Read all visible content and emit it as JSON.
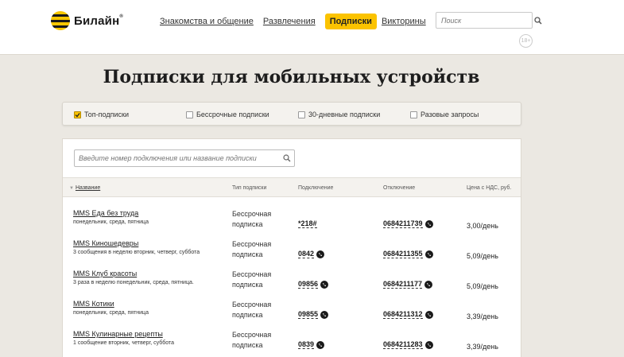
{
  "header": {
    "brand": "Билайн",
    "brand_mark": "®",
    "nav": [
      {
        "label": "Знакомства и общение",
        "active": false
      },
      {
        "label": "Развлечения",
        "active": false
      },
      {
        "label": "Подписки",
        "active": true
      },
      {
        "label": "Викторины",
        "active": false
      }
    ],
    "search_placeholder": "Поиск",
    "age_badge": "18+"
  },
  "page_title": "Подписки для мобильных устройств",
  "filters": [
    {
      "label": "Топ-подписки",
      "checked": true
    },
    {
      "label": "Бессрочные подписки",
      "checked": false
    },
    {
      "label": "30-дневные подписки",
      "checked": false
    },
    {
      "label": "Разовые запросы",
      "checked": false
    }
  ],
  "subscription_search": {
    "placeholder": "Введите номер подключения или название подписки"
  },
  "table": {
    "columns": {
      "name": "Название",
      "type": "Тип подписки",
      "connect": "Подключение",
      "disconnect": "Отключение",
      "price": "Цена с НДС, руб."
    },
    "rows": [
      {
        "name": "MMS Еда без труда",
        "desc": "понедельник, среда, пятница",
        "type": "Бессрочная подписка",
        "connect": "*218#",
        "connect_call": false,
        "disconnect": "0684211739",
        "price": "3,00/день"
      },
      {
        "name": "MMS Киношедевры",
        "desc": "3 сообщения в неделю вторник, четверг, суббота",
        "type": "Бессрочная подписка",
        "connect": "0842",
        "connect_call": true,
        "disconnect": "0684211355",
        "price": "5,09/день"
      },
      {
        "name": "MMS Клуб красоты",
        "desc": "3 раза в неделю понедельник, среда, пятница.",
        "type": "Бессрочная подписка",
        "connect": "09856",
        "connect_call": true,
        "disconnect": "0684211177",
        "price": "5,09/день"
      },
      {
        "name": "MMS Котики",
        "desc": "понедельник, среда, пятница",
        "type": "Бессрочная подписка",
        "connect": "09855",
        "connect_call": true,
        "disconnect": "0684211312",
        "price": "3,39/день"
      },
      {
        "name": "MMS Кулинарные рецепты",
        "desc": "1 сообщение вторник, четверг, суббота",
        "type": "Бессрочная подписка",
        "connect": "0839",
        "connect_call": true,
        "disconnect": "0684211283",
        "price": "3,39/день"
      }
    ]
  },
  "colors": {
    "accent": "#fbc300",
    "background": "#ebe8e2"
  }
}
